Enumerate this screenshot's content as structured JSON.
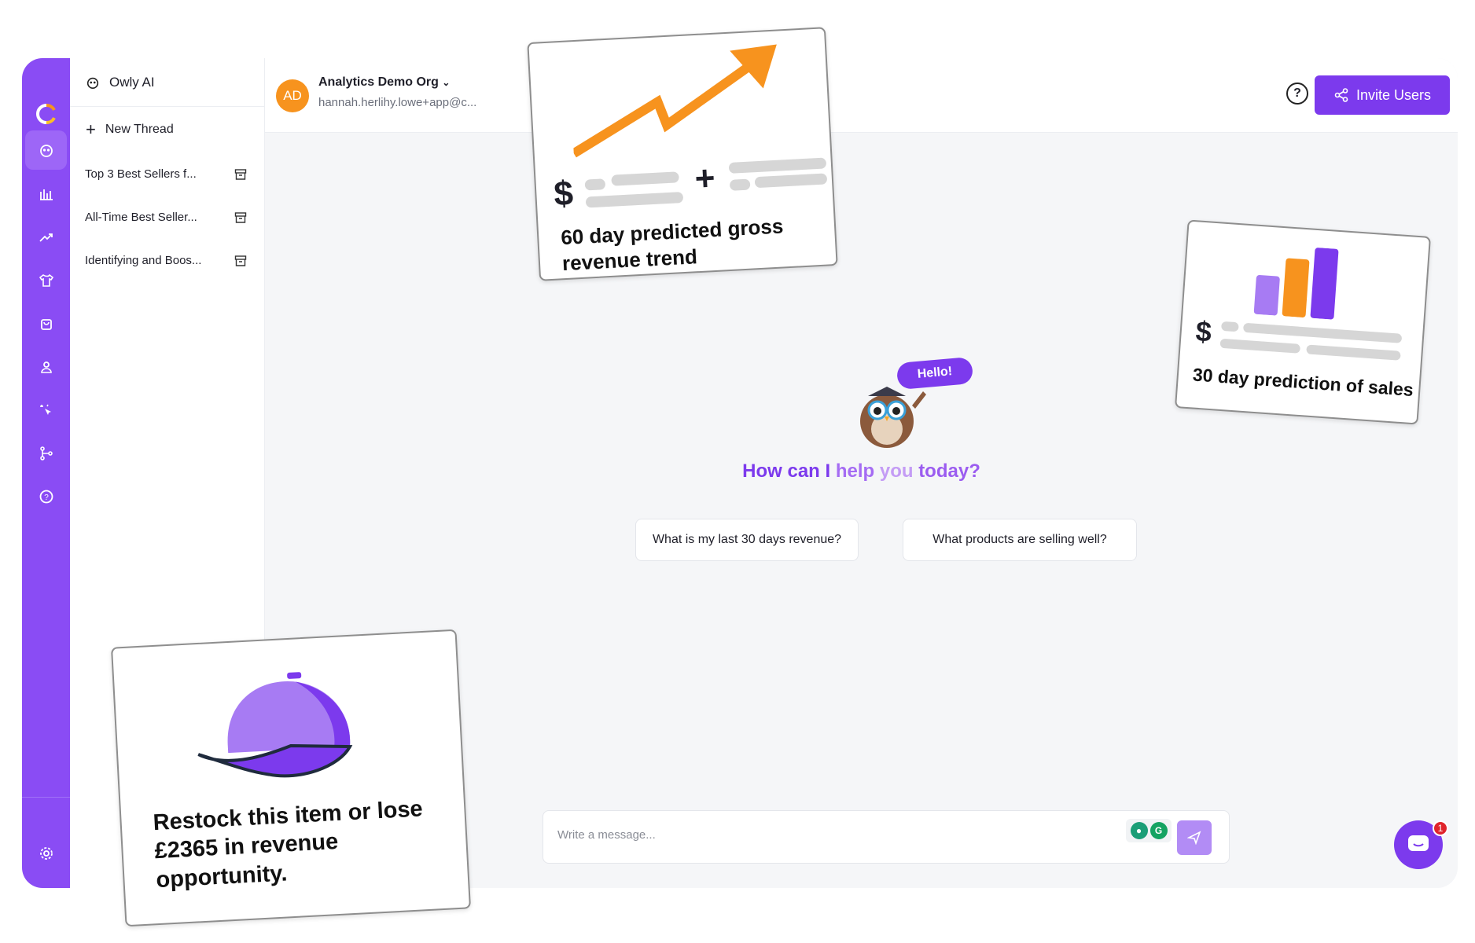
{
  "sidebar": {
    "title": "Owly AI",
    "new_thread": "New Thread",
    "threads": [
      {
        "label": "Top 3 Best Sellers f..."
      },
      {
        "label": "All-Time Best Seller..."
      },
      {
        "label": "Identifying and Boos..."
      }
    ],
    "rail_icons": [
      "logo-icon",
      "owl-icon",
      "bar-chart-icon",
      "trend-icon",
      "shirt-icon",
      "bag-icon",
      "user-icon",
      "sparkle-cursor-icon",
      "flow-icon",
      "help-icon",
      "settings-icon"
    ]
  },
  "header": {
    "avatar_initials": "AD",
    "org_name": "Analytics Demo Org",
    "email": "hannah.herlihy.lowe+app@c...",
    "invite_label": "Invite Users"
  },
  "main": {
    "greeting_parts": [
      "How can I ",
      "help ",
      "you ",
      "today?"
    ],
    "hello_bubble": "Hello!",
    "suggestions": [
      "What is my last 30 days revenue?",
      "What products are selling well?"
    ],
    "composer_placeholder": "Write a message...",
    "chat_badge": "1"
  },
  "cards": {
    "trend": {
      "caption": "60 day predicted gross revenue trend",
      "dollar": "$",
      "plus": "+"
    },
    "sales": {
      "caption": "30 day prediction of sales",
      "dollar": "$"
    },
    "restock": {
      "caption": "Restock this item or lose £2365 in revenue opportunity."
    }
  },
  "colors": {
    "brand": "#7c3aed",
    "accent": "#f7931e",
    "rail": "#8a4cf4"
  }
}
